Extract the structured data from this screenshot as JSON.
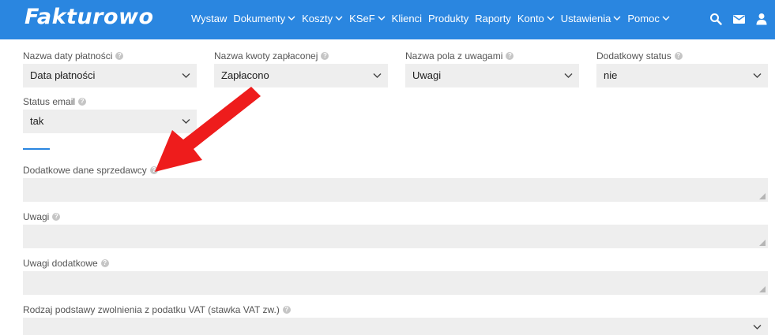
{
  "navbar": {
    "logo": "Fakturowo",
    "items": [
      {
        "label": "Wystaw",
        "dropdown": false
      },
      {
        "label": "Dokumenty",
        "dropdown": true
      },
      {
        "label": "Koszty",
        "dropdown": true
      },
      {
        "label": "KSeF",
        "dropdown": true
      },
      {
        "label": "Klienci",
        "dropdown": false
      },
      {
        "label": "Produkty",
        "dropdown": false
      },
      {
        "label": "Raporty",
        "dropdown": false
      },
      {
        "label": "Konto",
        "dropdown": true
      },
      {
        "label": "Ustawienia",
        "dropdown": true
      },
      {
        "label": "Pomoc",
        "dropdown": true
      }
    ],
    "icons": [
      "search-icon",
      "envelope-icon",
      "user-icon"
    ],
    "color": "#2a86e0"
  },
  "form": {
    "payment_date_name": {
      "label": "Nazwa daty płatności",
      "value": "Data płatności"
    },
    "paid_amount_name": {
      "label": "Nazwa kwoty zapłaconej",
      "value": "Zapłacono"
    },
    "notes_field_name": {
      "label": "Nazwa pola z uwagami",
      "value": "Uwagi"
    },
    "additional_status": {
      "label": "Dodatkowy status",
      "value": "nie"
    },
    "email_status": {
      "label": "Status email",
      "value": "tak"
    },
    "seller_additional_data": {
      "label": "Dodatkowe dane sprzedawcy",
      "value": ""
    },
    "notes": {
      "label": "Uwagi",
      "value": ""
    },
    "additional_notes": {
      "label": "Uwagi dodatkowe",
      "value": ""
    },
    "vat_exemption_basis": {
      "label": "Rodzaj podstawy zwolnienia z podatku VAT (stawka VAT zw.)",
      "value": ""
    }
  },
  "annotation": {
    "arrow_color": "#ee1c1c"
  }
}
